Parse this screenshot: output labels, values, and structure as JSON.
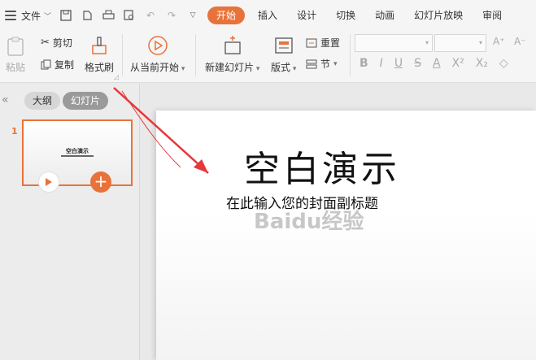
{
  "menu": {
    "file_label": "文件"
  },
  "tabs": [
    {
      "label": "开始",
      "active": true
    },
    {
      "label": "插入"
    },
    {
      "label": "设计"
    },
    {
      "label": "切换"
    },
    {
      "label": "动画"
    },
    {
      "label": "幻灯片放映"
    },
    {
      "label": "审阅"
    }
  ],
  "ribbon": {
    "paste": "粘贴",
    "cut": "剪切",
    "copy": "复制",
    "format_painter": "格式刷",
    "from_current": "从当前开始",
    "new_slide": "新建幻灯片",
    "layout": "版式",
    "reset": "重置",
    "section": "节"
  },
  "panel": {
    "outline_tab": "大纲",
    "slides_tab": "幻灯片",
    "slide_number": "1",
    "thumb_title": "空白演示"
  },
  "slide": {
    "title": "空白演示",
    "subtitle": "在此输入您的封面副标题"
  },
  "watermark": "Baidu经验",
  "colors": {
    "accent": "#e8733a",
    "annotation": "#e8373a"
  }
}
